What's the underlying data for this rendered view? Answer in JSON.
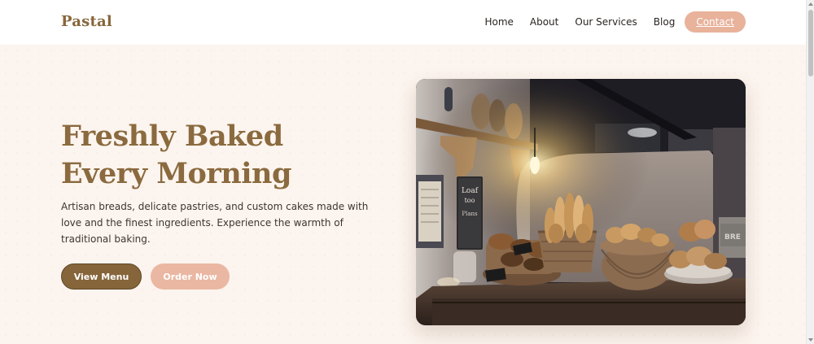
{
  "brand": {
    "name": "Pastal",
    "color": "#87663b"
  },
  "nav": {
    "links": [
      "Home",
      "About",
      "Our Services",
      "Blog"
    ],
    "contact": "Contact",
    "contact_color": "#e8b29b"
  },
  "hero": {
    "title_line1": "Freshly Baked",
    "title_line2": "Every Morning",
    "description": "Artisan breads, delicate pastries, and custom cakes made with love and the finest ingredients. Experience the warmth of traditional baking.",
    "primary_button": "View Menu",
    "secondary_button": "Order Now",
    "primary_color": "#86653a",
    "secondary_color": "#eab7a2",
    "image_subject": "bakery interior with bread baskets on a wooden counter",
    "image_text": {
      "board_line1": "Loaf",
      "board_line2": "too",
      "board_line3": "Plans",
      "wall_sign": "BRE"
    }
  }
}
